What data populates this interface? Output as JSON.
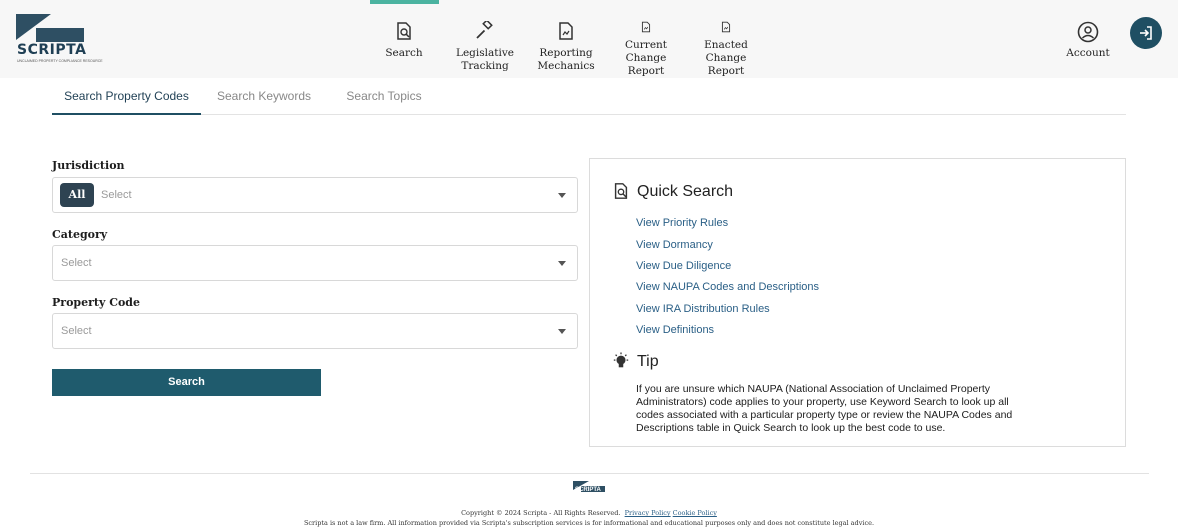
{
  "brand": {
    "name": "SCRIPTA",
    "tagline": "UNCLAIMED PROPERTY COMPLIANCE RESOURCE"
  },
  "nav": {
    "items": [
      {
        "label": "Search",
        "icon": "search-document-icon"
      },
      {
        "label": "Legislative\nTracking",
        "icon": "gavel-icon"
      },
      {
        "label": "Reporting\nMechanics",
        "icon": "document-icon"
      },
      {
        "label": "Current\nChange Report",
        "icon": "document-icon"
      },
      {
        "label": "Enacted\nChange Report",
        "icon": "document-icon"
      }
    ],
    "active": "Search",
    "account_label": "Account",
    "account_icon": "user-circle-icon",
    "logout_icon": "logout-icon",
    "accent_color": "#4bb3a0"
  },
  "tabs": [
    {
      "label": "Search Property Codes",
      "active": true
    },
    {
      "label": "Search Keywords",
      "active": false
    },
    {
      "label": "Search Topics",
      "active": false
    }
  ],
  "form": {
    "jurisdiction": {
      "label": "Jurisdiction",
      "chip": "All",
      "placeholder": "Select"
    },
    "category": {
      "label": "Category",
      "placeholder": "Select"
    },
    "property_code": {
      "label": "Property Code",
      "placeholder": "Select"
    },
    "search_button": "Search",
    "button_color": "#1f5b6d"
  },
  "quick_search": {
    "title": "Quick Search",
    "links": [
      "View Priority Rules",
      "View Dormancy",
      "View Due Diligence",
      "View NAUPA Codes and Descriptions",
      "View IRA Distribution Rules",
      "View Definitions"
    ]
  },
  "tip": {
    "title": "Tip",
    "text": "If you are unsure which NAUPA (National Association of Unclaimed Property Administrators) code applies to your property, use Keyword Search to look up all codes associated with a particular property type or review the NAUPA Codes and Descriptions table in Quick Search to look up the best code to use."
  },
  "footer": {
    "logo_text": "SCRIPTA",
    "copyright": "Copyright © 2024 Scripta - All Rights Reserved.",
    "privacy": "Privacy Policy",
    "cookie": "Cookie Policy",
    "disclaimer": "Scripta is not a law firm. All information provided via Scripta's subscription services is for informational and educational purposes only and does not constitute legal advice."
  }
}
